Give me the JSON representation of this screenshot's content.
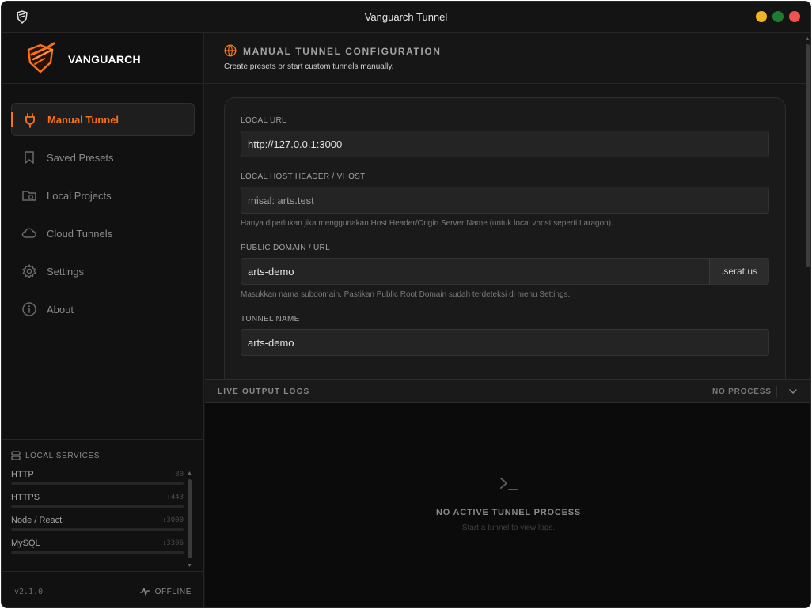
{
  "window": {
    "title": "Vanguarch Tunnel"
  },
  "brand": {
    "name": "VANGUARCH"
  },
  "nav": {
    "items": [
      {
        "label": "Manual Tunnel",
        "icon": "plug-icon",
        "active": true
      },
      {
        "label": "Saved Presets",
        "icon": "bookmark-icon"
      },
      {
        "label": "Local Projects",
        "icon": "folder-search-icon"
      },
      {
        "label": "Cloud Tunnels",
        "icon": "cloud-icon"
      },
      {
        "label": "Settings",
        "icon": "gear-icon"
      },
      {
        "label": "About",
        "icon": "info-icon"
      }
    ]
  },
  "services": {
    "title": "LOCAL SERVICES",
    "items": [
      {
        "name": "HTTP",
        "port": ":80"
      },
      {
        "name": "HTTPS",
        "port": ":443"
      },
      {
        "name": "Node / React",
        "port": ":3000"
      },
      {
        "name": "MySQL",
        "port": ":3306"
      }
    ]
  },
  "footer": {
    "version": "v2.1.0",
    "status": "OFFLINE"
  },
  "page": {
    "title": "MANUAL TUNNEL CONFIGURATION",
    "subtitle": "Create presets or start custom tunnels manually."
  },
  "form": {
    "local_url": {
      "label": "LOCAL URL",
      "value": "http://127.0.0.1:3000"
    },
    "host_header": {
      "label": "LOCAL HOST HEADER / VHOST",
      "placeholder": "misal: arts.test",
      "help": "Hanya diperlukan jika menggunakan Host Header/Origin Server Name (untuk local vhost seperti Laragon)."
    },
    "public_domain": {
      "label": "PUBLIC DOMAIN / URL",
      "value": "arts-demo",
      "suffix": ".serat.us",
      "help": "Masukkan nama subdomain. Pastikan Public Root Domain sudah terdeteksi di menu Settings."
    },
    "tunnel_name": {
      "label": "TUNNEL NAME",
      "value": "arts-demo"
    }
  },
  "logs": {
    "title": "LIVE OUTPUT LOGS",
    "status": "NO PROCESS",
    "empty_title": "NO ACTIVE TUNNEL PROCESS",
    "empty_sub": "Start a tunnel to view logs."
  },
  "colors": {
    "accent": "#f97316",
    "background": "#141414",
    "panel": "#1a1a1a"
  }
}
